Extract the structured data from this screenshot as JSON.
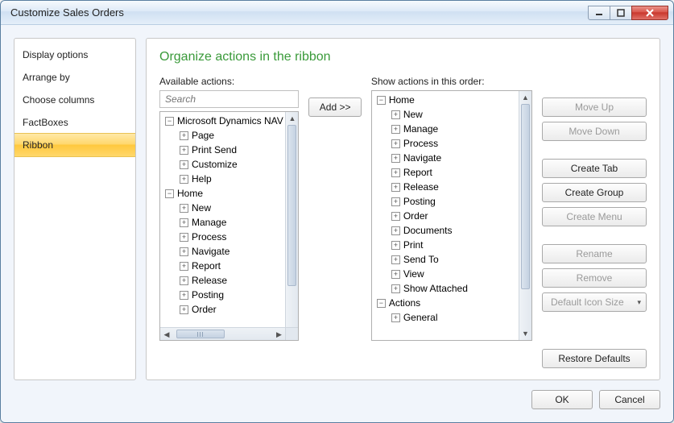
{
  "window": {
    "title": "Customize Sales Orders"
  },
  "sidebar": {
    "items": [
      {
        "label": "Display options"
      },
      {
        "label": "Arrange by"
      },
      {
        "label": "Choose columns"
      },
      {
        "label": "FactBoxes"
      },
      {
        "label": "Ribbon",
        "selected": true
      }
    ]
  },
  "section": {
    "title": "Organize actions in the ribbon",
    "available_label": "Available actions:",
    "order_label": "Show actions in this order:",
    "search_placeholder": "Search",
    "add_button": "Add >>"
  },
  "available_tree": [
    {
      "level": 0,
      "toggle": "-",
      "label": "Microsoft Dynamics NAV"
    },
    {
      "level": 1,
      "toggle": "+",
      "label": "Page"
    },
    {
      "level": 1,
      "toggle": "+",
      "label": "Print  Send"
    },
    {
      "level": 1,
      "toggle": "+",
      "label": "Customize"
    },
    {
      "level": 1,
      "toggle": "+",
      "label": "Help"
    },
    {
      "level": 0,
      "toggle": "-",
      "label": "Home"
    },
    {
      "level": 1,
      "toggle": "+",
      "label": "New"
    },
    {
      "level": 1,
      "toggle": "+",
      "label": "Manage"
    },
    {
      "level": 1,
      "toggle": "+",
      "label": "Process"
    },
    {
      "level": 1,
      "toggle": "+",
      "label": "Navigate"
    },
    {
      "level": 1,
      "toggle": "+",
      "label": "Report"
    },
    {
      "level": 1,
      "toggle": "+",
      "label": "Release"
    },
    {
      "level": 1,
      "toggle": "+",
      "label": "Posting"
    },
    {
      "level": 1,
      "toggle": "+",
      "label": "Order"
    }
  ],
  "order_tree": [
    {
      "level": 0,
      "toggle": "-",
      "label": "Home"
    },
    {
      "level": 1,
      "toggle": "+",
      "label": "New"
    },
    {
      "level": 1,
      "toggle": "+",
      "label": "Manage"
    },
    {
      "level": 1,
      "toggle": "+",
      "label": "Process"
    },
    {
      "level": 1,
      "toggle": "+",
      "label": "Navigate"
    },
    {
      "level": 1,
      "toggle": "+",
      "label": "Report"
    },
    {
      "level": 1,
      "toggle": "+",
      "label": "Release"
    },
    {
      "level": 1,
      "toggle": "+",
      "label": "Posting"
    },
    {
      "level": 1,
      "toggle": "+",
      "label": "Order"
    },
    {
      "level": 1,
      "toggle": "+",
      "label": "Documents"
    },
    {
      "level": 1,
      "toggle": "+",
      "label": "Print"
    },
    {
      "level": 1,
      "toggle": "+",
      "label": "Send To"
    },
    {
      "level": 1,
      "toggle": "+",
      "label": "View"
    },
    {
      "level": 1,
      "toggle": "+",
      "label": "Show Attached"
    },
    {
      "level": 0,
      "toggle": "-",
      "label": "Actions"
    },
    {
      "level": 1,
      "toggle": "+",
      "label": "General"
    }
  ],
  "buttons": {
    "move_up": "Move Up",
    "move_down": "Move Down",
    "create_tab": "Create Tab",
    "create_group": "Create Group",
    "create_menu": "Create Menu",
    "rename": "Rename",
    "remove": "Remove",
    "icon_size": "Default Icon Size",
    "restore": "Restore Defaults",
    "ok": "OK",
    "cancel": "Cancel"
  }
}
